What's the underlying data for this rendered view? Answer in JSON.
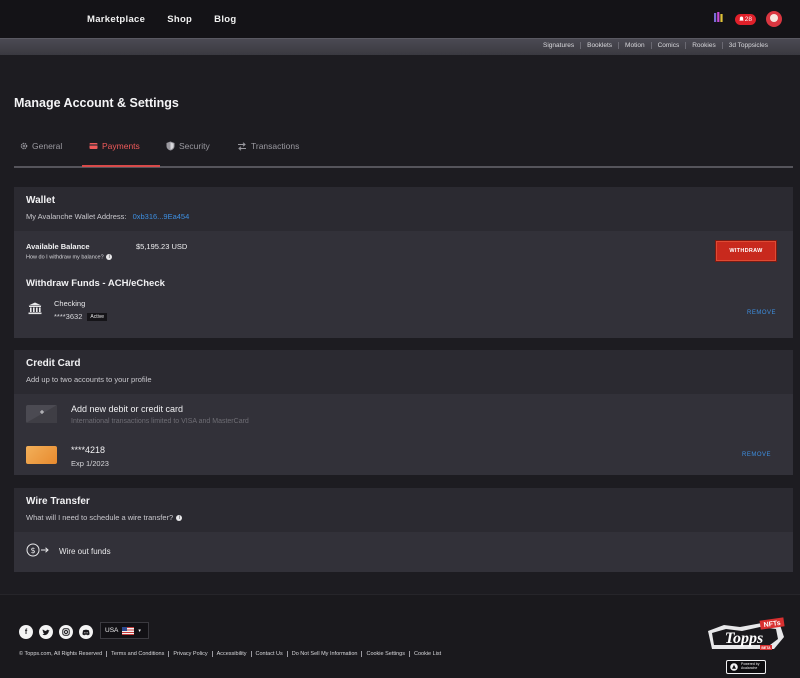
{
  "topnav": {
    "links": [
      "Marketplace",
      "Shop",
      "Blog"
    ],
    "notification_count": "28"
  },
  "subnav": {
    "items": [
      "Signatures",
      "Booklets",
      "Motion",
      "Comics",
      "Rookies",
      "3d Toppsicles"
    ]
  },
  "page": {
    "title": "Manage Account & Settings"
  },
  "tabs": [
    {
      "label": "General",
      "icon": "gear-icon"
    },
    {
      "label": "Payments",
      "icon": "card-icon",
      "active": true
    },
    {
      "label": "Security",
      "icon": "shield-icon"
    },
    {
      "label": "Transactions",
      "icon": "transfer-arrows-icon"
    }
  ],
  "wallet": {
    "title": "Wallet",
    "address_label": "My Avalanche Wallet Address:",
    "address_value": "0xb316...9Ea454",
    "balance_label": "Available Balance",
    "balance_value": "$5,195.23 USD",
    "help_text": "How do I withdraw my balance?",
    "withdraw_button": "WITHDRAW",
    "withdraw_title": "Withdraw Funds - ACH/eCheck",
    "account_type": "Checking",
    "account_number": "****3632",
    "account_status": "Active",
    "remove_label": "REMOVE"
  },
  "credit_card": {
    "title": "Credit Card",
    "subtitle": "Add up to two accounts to your profile",
    "add_title": "Add new debit or credit card",
    "add_note": "International transactions limited to VISA and MasterCard",
    "card_number": "****4218",
    "card_expiry": "Exp 1/2023",
    "remove_label": "REMOVE"
  },
  "wire": {
    "title": "Wire Transfer",
    "question": "What will I need to schedule a wire transfer?",
    "action": "Wire out funds"
  },
  "footer": {
    "region": "USA",
    "legal": [
      "© Topps.com, All Rights Reserved",
      "Terms and Conditions",
      "Privacy Policy",
      "Accessibility",
      "Contact Us",
      "Do Not Sell My Information",
      "Cookie Settings",
      "Cookie List"
    ],
    "logo_text": "Topps NFTs BETA",
    "powered_by": "Powered by Avalanche"
  },
  "colors": {
    "accent_red": "#d84a4a",
    "link_blue": "#3d8ee0",
    "withdraw_red": "#c8291d"
  }
}
